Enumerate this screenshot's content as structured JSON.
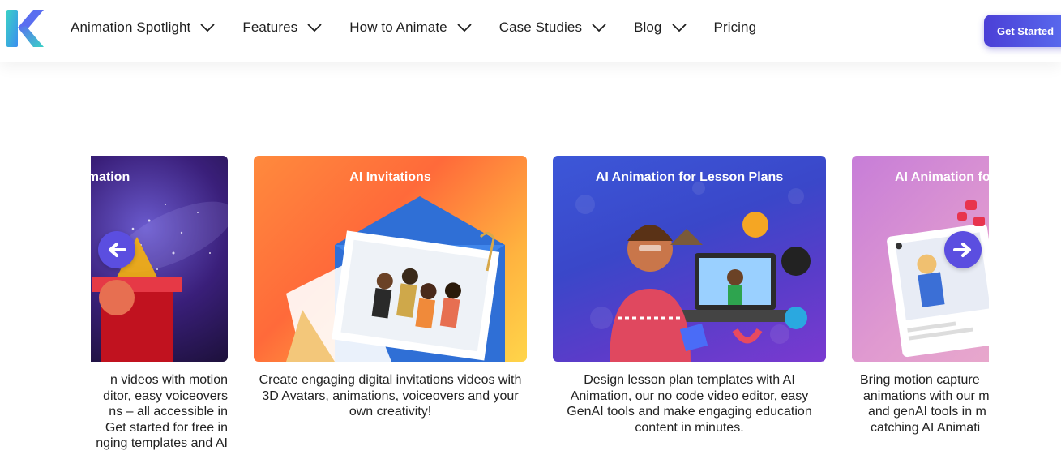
{
  "header": {
    "logo_letter": "K",
    "nav": [
      {
        "label": "Animation Spotlight",
        "dropdown": true
      },
      {
        "label": "Features",
        "dropdown": true
      },
      {
        "label": "How to Animate",
        "dropdown": true
      },
      {
        "label": "Case Studies",
        "dropdown": true
      },
      {
        "label": "Blog",
        "dropdown": true
      },
      {
        "label": "Pricing",
        "dropdown": false
      }
    ],
    "cta_label": "Get Started"
  },
  "cards": [
    {
      "title": "AI Animation",
      "desc": "... videos with motion ... editor, easy voiceovers ... ns – all accessible in ... Get started for free in ... nging templates and AI ..."
    },
    {
      "title": "AI Invitations",
      "desc": "Create engaging digital invitations videos with 3D Avatars, animations, voiceovers and your own creativity!"
    },
    {
      "title": "AI Animation for Lesson Plans",
      "desc": "Design lesson plan templates with AI Animation, our no code video editor, easy GenAI tools and make engaging education content in minutes."
    },
    {
      "title": "AI Animation for ...",
      "desc": "Bring motion capture ... animations with our ... and genAI tools in ... catching AI Animati..."
    }
  ],
  "card0_lines": [
    "n videos with motion",
    "ditor, easy voiceovers",
    "ns – all accessible in",
    "Get started for free in",
    "nging templates and AI"
  ],
  "card3_lines": [
    "Bring motion capture",
    "animations with our m",
    "and genAI tools in m",
    "catching AI Animati"
  ],
  "card0_title_visible": "Animation",
  "card3_title_visible": "AI Animation fo",
  "arrows": {
    "prev": "arrow-left-icon",
    "next": "arrow-right-icon"
  },
  "colors": {
    "accent": "#5b4ee0",
    "cta_start": "#4b3fd6",
    "cta_end": "#5a6ef0"
  }
}
